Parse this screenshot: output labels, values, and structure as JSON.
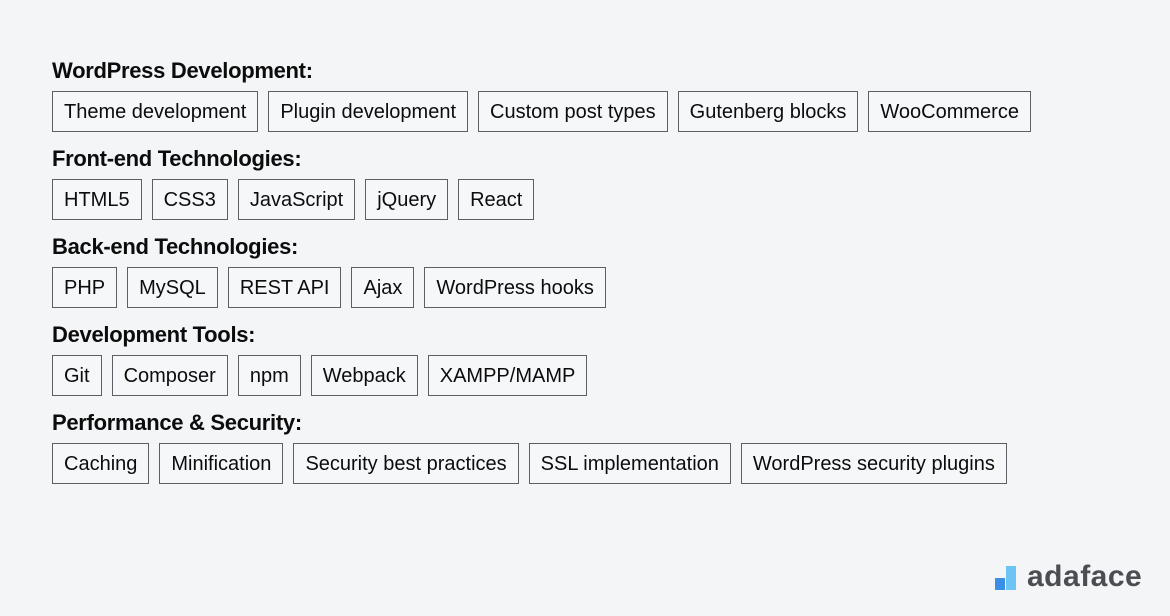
{
  "sections": [
    {
      "title": "WordPress Development:",
      "skills": [
        "Theme development",
        "Plugin development",
        "Custom post types",
        "Gutenberg blocks",
        "WooCommerce"
      ]
    },
    {
      "title": "Front-end Technologies:",
      "skills": [
        "HTML5",
        "CSS3",
        "JavaScript",
        "jQuery",
        "React"
      ]
    },
    {
      "title": "Back-end Technologies:",
      "skills": [
        "PHP",
        "MySQL",
        "REST API",
        "Ajax",
        "WordPress hooks"
      ]
    },
    {
      "title": "Development Tools:",
      "skills": [
        "Git",
        "Composer",
        "npm",
        "Webpack",
        "XAMPP/MAMP"
      ]
    },
    {
      "title": "Performance & Security:",
      "skills": [
        "Caching",
        "Minification",
        "Security best practices",
        "SSL implementation",
        "WordPress security plugins"
      ]
    }
  ],
  "brand": {
    "name": "adaface",
    "icon": "bar-chart-logo-icon"
  }
}
